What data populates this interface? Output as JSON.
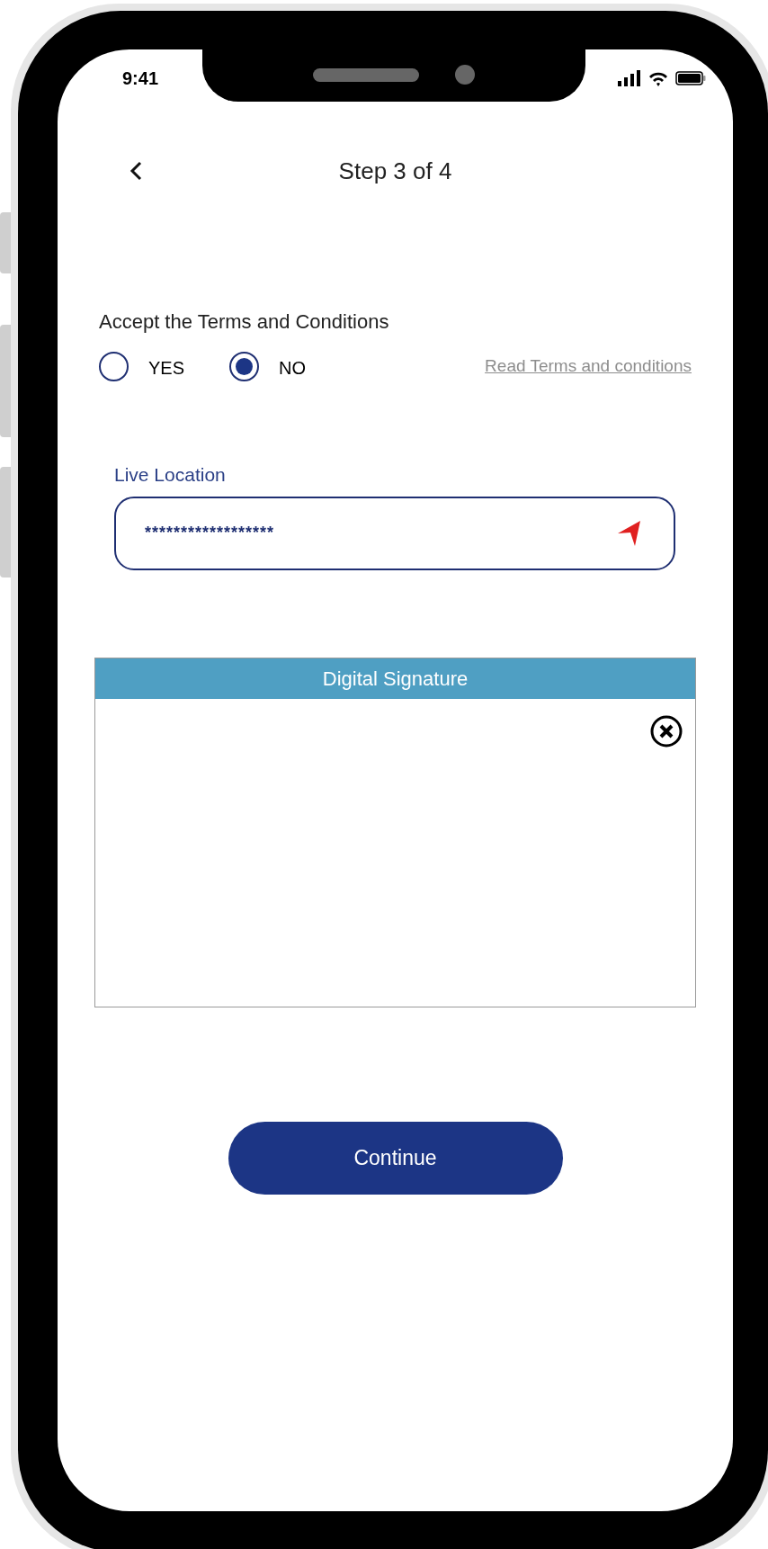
{
  "status_bar": {
    "time": "9:41"
  },
  "header": {
    "title": "Step 3 of 4"
  },
  "terms": {
    "question": "Accept the Terms and Conditions",
    "options": [
      {
        "label": "YES",
        "selected": false
      },
      {
        "label": "NO",
        "selected": true
      }
    ],
    "link": "Read Terms and conditions"
  },
  "live_location": {
    "label": "Live Location",
    "value": "******************"
  },
  "signature": {
    "title": "Digital Signature"
  },
  "continue_button": "Continue"
}
